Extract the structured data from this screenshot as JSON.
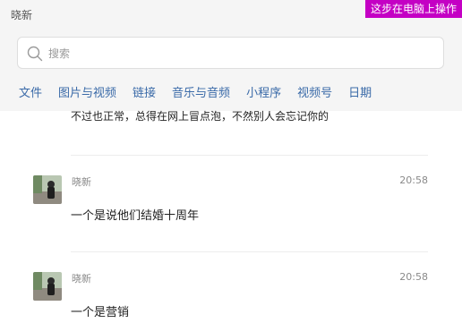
{
  "window": {
    "title": "晓新"
  },
  "banner": {
    "text": "这步在电脑上操作"
  },
  "search": {
    "placeholder": "搜索",
    "value": ""
  },
  "tabs": [
    {
      "label": "文件"
    },
    {
      "label": "图片与视频"
    },
    {
      "label": "链接"
    },
    {
      "label": "音乐与音频"
    },
    {
      "label": "小程序"
    },
    {
      "label": "视频号"
    },
    {
      "label": "日期"
    }
  ],
  "results": {
    "partial_text": "不过也正常，总得在网上冒点泡，不然别人会忘记你的",
    "items": [
      {
        "sender": "晓新",
        "time": "20:58",
        "text": "一个是说他们结婚十周年"
      },
      {
        "sender": "晓新",
        "time": "20:58",
        "text": "一个是营销"
      }
    ]
  },
  "colors": {
    "banner": "#c400c4",
    "tab": "#3a6aa8",
    "topbar": "#f5f5f5"
  }
}
